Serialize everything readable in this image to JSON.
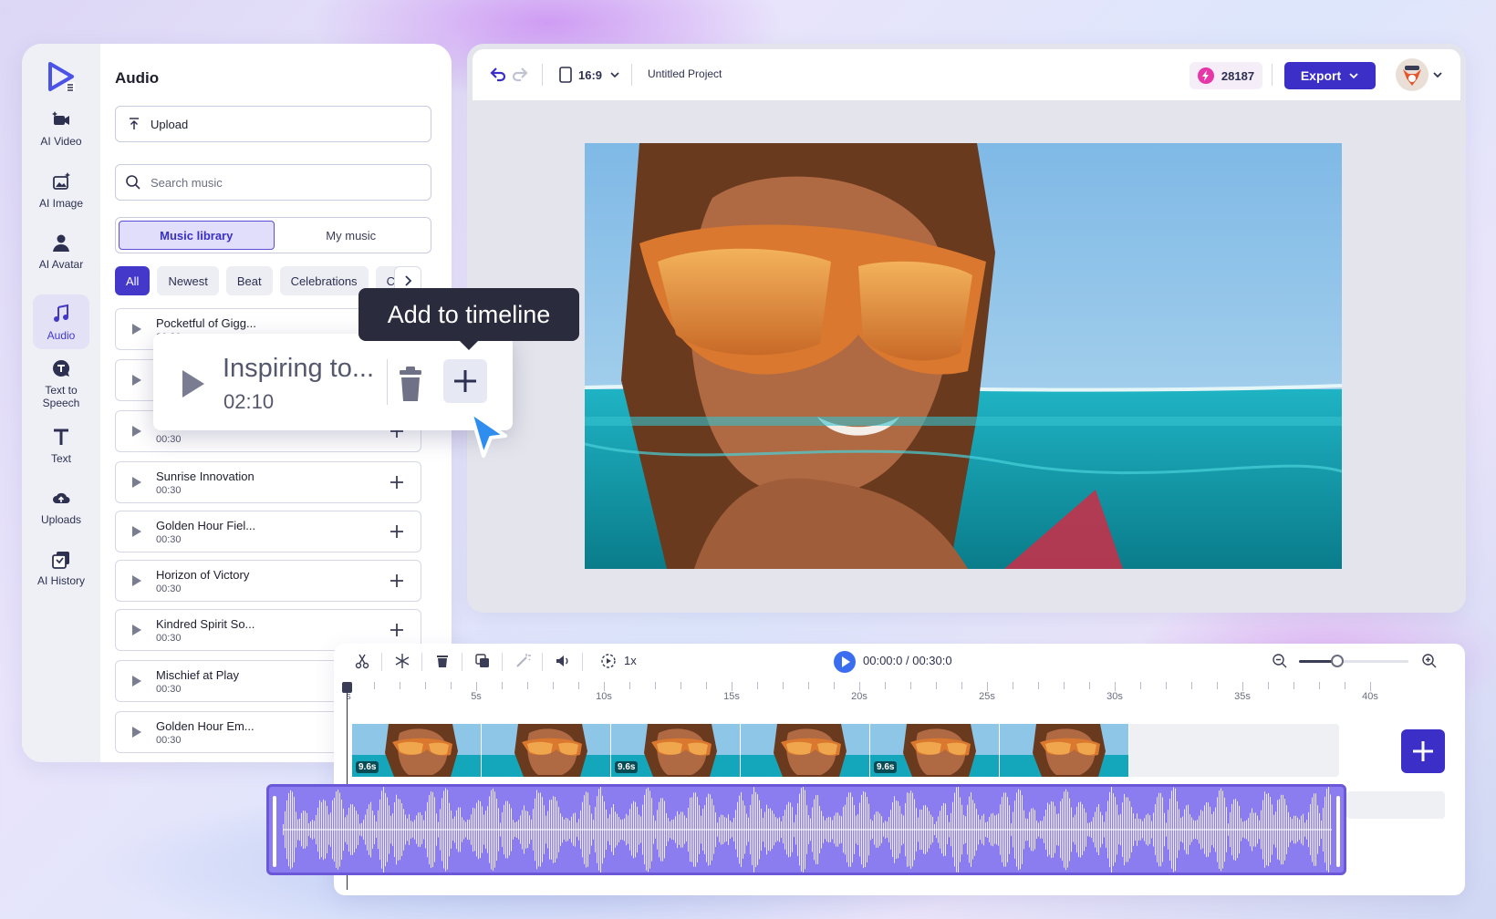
{
  "colors": {
    "accent": "#3b2fc7",
    "active_nav": "#4338ca",
    "audio_track": "#8b7cf0",
    "credit_bolt": "#e636a8",
    "play": "#3b6df0"
  },
  "rail": {
    "items": [
      {
        "label": "AI Video",
        "icon": "ai-video-icon"
      },
      {
        "label": "AI Image",
        "icon": "ai-image-icon"
      },
      {
        "label": "AI Avatar",
        "icon": "avatar-icon"
      },
      {
        "label": "Audio",
        "icon": "music-note-icon",
        "active": true
      },
      {
        "label": "Text to Speech",
        "icon": "text-to-speech-icon"
      },
      {
        "label": "Text",
        "icon": "text-icon"
      },
      {
        "label": "Uploads",
        "icon": "cloud-upload-icon"
      },
      {
        "label": "AI History",
        "icon": "history-icon"
      }
    ]
  },
  "panel": {
    "title": "Audio",
    "upload_label": "Upload",
    "search_placeholder": "Search music",
    "tabs": [
      {
        "label": "Music library",
        "active": true
      },
      {
        "label": "My music",
        "active": false
      }
    ],
    "chips": [
      {
        "label": "All",
        "active": true
      },
      {
        "label": "Newest"
      },
      {
        "label": "Beat"
      },
      {
        "label": "Celebrations"
      },
      {
        "label": "C"
      }
    ],
    "tracks": [
      {
        "name": "Pocketful of Gigg...",
        "duration": "00:30"
      },
      {
        "name": "",
        "duration": ""
      },
      {
        "name": "",
        "duration": "00:30"
      },
      {
        "name": "Sunrise Innovation",
        "duration": "00:30"
      },
      {
        "name": "Golden Hour Fiel...",
        "duration": "00:30"
      },
      {
        "name": "Horizon of Victory",
        "duration": "00:30"
      },
      {
        "name": "Kindred Spirit So...",
        "duration": "00:30"
      },
      {
        "name": "Mischief at Play",
        "duration": "00:30"
      },
      {
        "name": "Golden Hour Em...",
        "duration": "00:30"
      }
    ]
  },
  "popup": {
    "title": "Inspiring to...",
    "duration": "02:10",
    "tooltip": "Add to timeline"
  },
  "topbar": {
    "aspect_ratio": "16:9",
    "project_title": "Untitled Project",
    "credits": "28187",
    "export_label": "Export"
  },
  "timeline": {
    "speed": "1x",
    "time": "00:00:0 / 00:30:0",
    "zoom_level": 0.35,
    "ruler": [
      "s",
      "5s",
      "10s",
      "15s",
      "20s",
      "25s",
      "30s",
      "35s",
      "40s"
    ],
    "clips": [
      "9.6s",
      "",
      "9.6s",
      "",
      "9.6s",
      ""
    ]
  }
}
